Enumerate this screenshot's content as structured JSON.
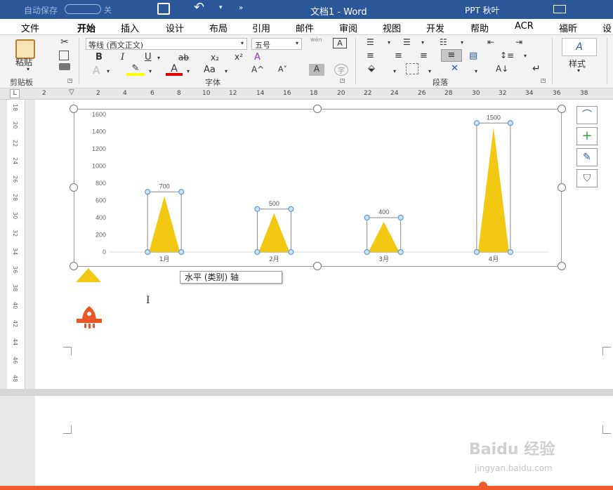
{
  "titlebar": {
    "autosave_label": "自动保存",
    "toggle_state": "关",
    "document_title": "文档1 - Word",
    "user_name": "PPT 秋叶"
  },
  "tabs": [
    "文件",
    "开始",
    "插入",
    "设计",
    "布局",
    "引用",
    "邮件",
    "审阅",
    "视图",
    "开发",
    "帮助",
    "ACR",
    "福昕",
    "设"
  ],
  "ribbon": {
    "paste_label": "粘贴",
    "clipboard_group": "剪贴板",
    "font_name": "等线 (西文正文)",
    "font_size": "五号",
    "font_group": "字体",
    "paragraph_group": "段落",
    "styles_label": "样式",
    "bold": "B",
    "italic": "I",
    "underline": "U",
    "strike": "ab",
    "subscript": "x₂",
    "superscript": "x²",
    "clear_format_icon": "A",
    "text_effect": "A",
    "font_color": "A",
    "change_case": "Aa",
    "grow": "A^",
    "shrink": "A˅",
    "wen_label": "wén"
  },
  "ruler_h": [
    "2",
    "2",
    "4",
    "6",
    "8",
    "10",
    "12",
    "14",
    "16",
    "18",
    "20",
    "22",
    "24",
    "26",
    "28",
    "30",
    "32",
    "34",
    "36",
    "38"
  ],
  "ruler_v": [
    "18",
    "20",
    "22",
    "24",
    "26",
    "28",
    "30",
    "32",
    "34",
    "36",
    "38",
    "40",
    "42",
    "44",
    "46",
    "48"
  ],
  "tooltip": "水平 (类别) 轴",
  "watermark": {
    "brand": "Baidu 经验",
    "url": "jingyan.baidu.com"
  },
  "colors": {
    "accent": "#2b579a",
    "bar": "#f2c813",
    "handle": "#5b9bd5",
    "bottom_bar": "#f25c2d"
  },
  "chart_data": {
    "type": "bar",
    "categories": [
      "1月",
      "2月",
      "3月",
      "4月"
    ],
    "values": [
      700,
      500,
      400,
      1500
    ],
    "ylim": [
      0,
      1600
    ],
    "yticks": [
      0,
      200,
      400,
      600,
      800,
      1000,
      1200,
      1400,
      1600
    ],
    "bar_shape": "triangle",
    "data_labels": [
      "700",
      "500",
      "400",
      "1500"
    ],
    "grid": false,
    "legend": "none"
  }
}
